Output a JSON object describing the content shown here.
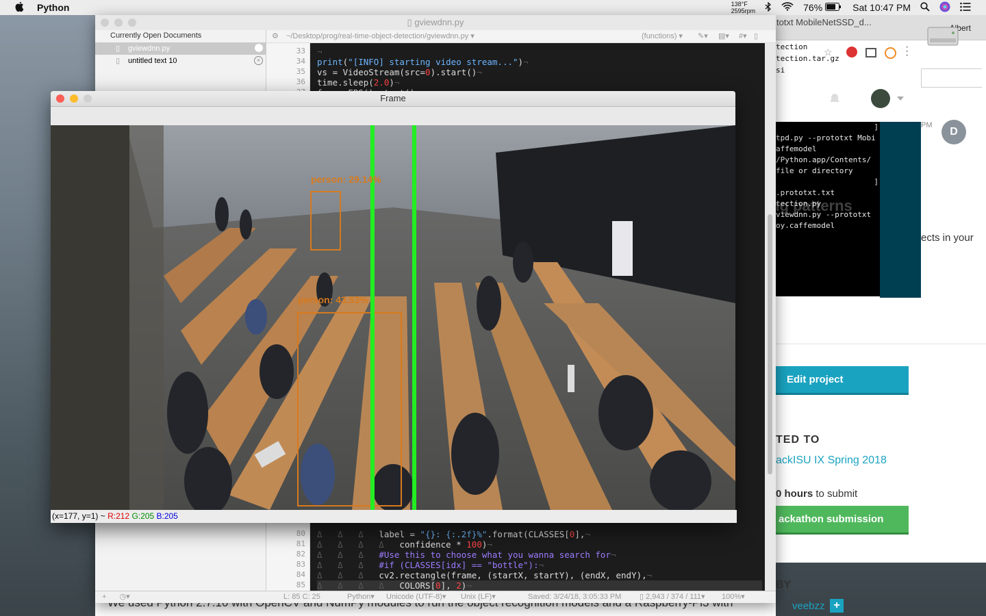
{
  "menubar": {
    "app_name": "Python",
    "temp_line1": "138°F",
    "temp_line2": "2595rpm",
    "battery": "76%",
    "clock": "Sat 10:47 PM"
  },
  "browser": {
    "tab_title": "totxt MobileNetSSD_d...",
    "user": "Albert",
    "top_lines": [
      "tection",
      "tection.tar.gz",
      "si"
    ],
    "terminal_lines": [
      "]",
      "tpd.py --prototxt Mobi",
      "affemodel",
      "/Python.app/Contents/",
      "file or directory",
      "]",
      ".prototxt.txt",
      "tection.py",
      "viewdnn.py --prototxt",
      "oy.caffemodel"
    ],
    "faded_heading": "ng patterns",
    "side_text": "ects in your",
    "avatar": "D",
    "time_fragment": "PM",
    "edit_button": "Edit project",
    "submitted_heading": "TED TO",
    "hackathon_link": "ackISU IX Spring 2018",
    "hours_bold": "0 hours",
    "hours_rest": "to submit",
    "submission_button": "ackathon submission",
    "by_heading": "BY",
    "by_user": "veebzz",
    "plus": "+"
  },
  "editor": {
    "title": "gviewdnn.py",
    "path": "~/Desktop/prog/real-time-object-detection/gviewdnn.py",
    "functions": "(functions)",
    "sidebar_header": "Currently Open Documents",
    "docs": [
      "gviewdnn.py",
      "untitled text 10"
    ],
    "line_numbers_top": [
      "33",
      "34",
      "35",
      "36",
      "37"
    ],
    "line_numbers_bottom": [
      "80",
      "81",
      "82",
      "83",
      "84",
      "85"
    ],
    "status": {
      "position": "L: 85 C: 25",
      "language": "Python",
      "encoding": "Unicode (UTF-8)",
      "line_endings": "Unix (LF)",
      "saved": "Saved: 3/24/18, 3:05:33 PM",
      "counts": "2,943 / 374 / 111",
      "zoom": "100%"
    }
  },
  "frame": {
    "title": "Frame",
    "status_coords": "(x=177, y=1) ~",
    "status_r": "R:212",
    "status_g": "G:205",
    "status_b": "B:205",
    "detections": [
      {
        "label": "person: 29.14%"
      },
      {
        "label": "person: 43.53%"
      }
    ]
  },
  "page_text": "We used Python 2.7.10 with OpenCV and NumPy modules to run the object recognition models and a Raspberry-Pi3 with",
  "colors": {
    "detection_box": "#d77a1e",
    "line_green": "#22ee22",
    "edit_button": "#1aa3c0",
    "submit_button": "#4fb85c"
  }
}
